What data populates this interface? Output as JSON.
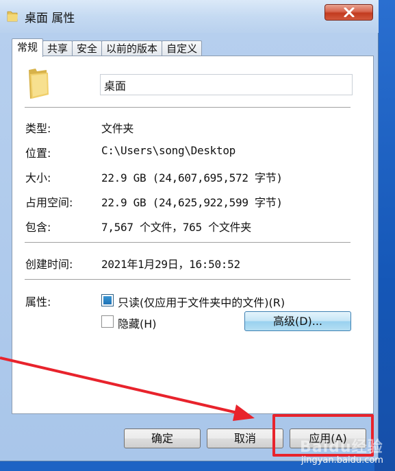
{
  "window": {
    "title": "桌面 属性",
    "close_icon": "close-icon"
  },
  "tabs": [
    {
      "label": "常规",
      "active": true
    },
    {
      "label": "共享",
      "active": false
    },
    {
      "label": "安全",
      "active": false
    },
    {
      "label": "以前的版本",
      "active": false
    },
    {
      "label": "自定义",
      "active": false
    }
  ],
  "general": {
    "folder_icon": "folder-icon",
    "name_value": "桌面",
    "type_label": "类型:",
    "type_value": "文件夹",
    "location_label": "位置:",
    "location_value": "C:\\Users\\song\\Desktop",
    "size_label": "大小:",
    "size_value": "22.9 GB (24,607,695,572 字节)",
    "size_on_disk_label": "占用空间:",
    "size_on_disk_value": "22.9 GB (24,625,922,599 字节)",
    "contains_label": "包含:",
    "contains_value": "7,567 个文件，765 个文件夹",
    "created_label": "创建时间:",
    "created_value": "2021年1月29日，16:50:52",
    "attributes_label": "属性:",
    "readonly_label": "只读(仅应用于文件夹中的文件)(R)",
    "readonly_checked": true,
    "hidden_label": "隐藏(H)",
    "hidden_checked": false,
    "advanced_label": "高级(D)..."
  },
  "footer": {
    "ok_label": "确定",
    "cancel_label": "取消",
    "apply_label": "应用(A)"
  },
  "annotation": {
    "arrow_color": "#e8232c",
    "highlight_color": "#e8232c"
  },
  "watermark": {
    "logo_text": "Baidu经验",
    "url": "jingyan.baidu.com"
  }
}
